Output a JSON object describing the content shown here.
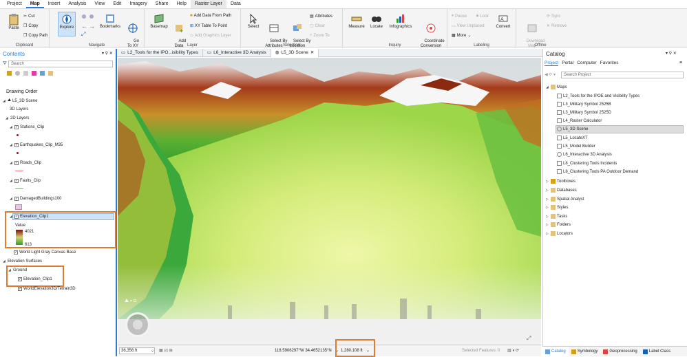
{
  "menu": {
    "items": [
      "Project",
      "Map",
      "Insert",
      "Analysis",
      "View",
      "Edit",
      "Imagery",
      "Share",
      "Help"
    ],
    "active": "Map",
    "context_tabs": [
      "Raster Layer",
      "Data"
    ]
  },
  "ribbon": {
    "clipboard": {
      "label": "Clipboard",
      "paste": "Paste",
      "cut": "Cut",
      "copy": "Copy",
      "copy_path": "Copy Path"
    },
    "navigate": {
      "label": "Navigate",
      "explore": "Explore",
      "bookmarks": "Bookmarks",
      "go_to_xy": "Go\nTo XY"
    },
    "layer": {
      "label": "Layer",
      "basemap": "Basemap",
      "add_data": "Add\nData",
      "add_data_from_path": "Add Data From Path",
      "xy_table": "XY Table To Point",
      "add_graphics": "Add Graphics Layer"
    },
    "selection": {
      "label": "Selection",
      "select": "Select",
      "select_by_attributes": "Select By\nAttributes",
      "select_by_location": "Select By\nLocation",
      "attributes": "Attributes",
      "clear": "Clear",
      "zoom_to": "Zoom To"
    },
    "inquiry": {
      "label": "Inquiry",
      "measure": "Measure",
      "locate": "Locate",
      "infographics": "Infographics",
      "coordinate_conversion": "Coordinate\nConversion"
    },
    "labeling": {
      "label": "Labeling",
      "pause": "Pause",
      "lock": "Lock",
      "view_unplaced": "View Unplaced",
      "more": "More",
      "convert": "Convert"
    },
    "offline": {
      "label": "Offline",
      "download_map": "Download\nMap",
      "sync": "Sync",
      "remove": "Remove"
    }
  },
  "map_tabs": [
    {
      "label": "L2_Tools for the IPO...isibility Types",
      "active": false
    },
    {
      "label": "L6_Interactive 3D Analysis",
      "active": false
    },
    {
      "label": "L5_3D Scene",
      "active": true
    }
  ],
  "contents": {
    "title": "Contents",
    "search_placeholder": "Search",
    "drawing_order": "Drawing Order",
    "scene": "L5_3D Scene",
    "layers_3d": "3D Layers",
    "layers_2d": "2D Layers",
    "layers": [
      {
        "name": "Stations_Clip",
        "checked": true
      },
      {
        "name": "Earthquakes_Clip_M35",
        "checked": true
      },
      {
        "name": "Roads_Clip",
        "checked": true
      },
      {
        "name": "Faults_Clip",
        "checked": true
      },
      {
        "name": "DamagedBuildings100",
        "checked": true
      }
    ],
    "elevation_layer": {
      "name": "Elevation_Clip1",
      "value_label": "Value",
      "max": "4021",
      "min": "613"
    },
    "basemap": "World Light Gray Canvas Base",
    "elevation_surfaces": "Elevation Surfaces",
    "ground": "Ground",
    "ground_items": [
      "Elevation_Clip1",
      "WorldElevation3D/Terrain3D"
    ]
  },
  "status": {
    "scale": "36,356 ft",
    "coords": "118.5906297°W 34.4652135°N",
    "elevation": "1,280.108 ft",
    "selected_features": "Selected Features: 0"
  },
  "catalog": {
    "title": "Catalog",
    "tabs": [
      "Project",
      "Portal",
      "Computer",
      "Favorites"
    ],
    "active_tab": "Project",
    "search_placeholder": "Search Project",
    "maps_label": "Maps",
    "maps": [
      "L2_Tools for the IPOE and Visibility Types",
      "L3_Military Symbol 2525B",
      "L3_Military Symbol 2525D",
      "L4_Raster Calculator",
      "L5_3D Scene",
      "L5_LocateXT",
      "L5_Model Builder",
      "L6_Interactive 3D Analysis",
      "L8_Clustering Tools Incidents",
      "L8_Clustering Tools PA Outdoor Demand"
    ],
    "selected_map": "L5_3D Scene",
    "folders": [
      "Toolboxes",
      "Databases",
      "Spatial Analyst",
      "Styles",
      "Tasks",
      "Folders",
      "Locators"
    ]
  },
  "bottom_tabs": [
    "Catalog",
    "Symbology",
    "Geoprocessing",
    "Label Class"
  ],
  "colors": {
    "accent": "#2a7ad2",
    "highlight": "#e07a2e",
    "selected_row": "#cfe3f7"
  }
}
